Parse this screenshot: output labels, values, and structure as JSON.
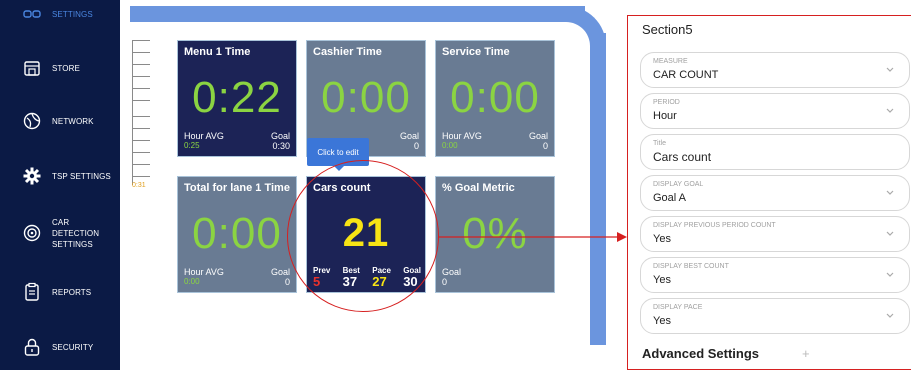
{
  "sidebar": {
    "items": [
      {
        "label": "SETTINGS",
        "icon": "settings-grid-icon",
        "active": true
      },
      {
        "label": "STORE",
        "icon": "store-icon"
      },
      {
        "label": "NETWORK",
        "icon": "network-icon"
      },
      {
        "label": "TSP SETTINGS",
        "icon": "gear-icon"
      },
      {
        "label": "CAR DETECTION SETTINGS",
        "icon": "car-detection-icon"
      },
      {
        "label": "REPORTS",
        "icon": "clipboard-icon"
      },
      {
        "label": "SECURITY",
        "icon": "lock-icon"
      }
    ]
  },
  "timeline": {
    "label": "0:31"
  },
  "tiles": [
    {
      "title": "Menu 1 Time",
      "value": "0:22",
      "foot_left": "Hour AVG",
      "foot_left_sub": "0:25",
      "foot_right": "Goal",
      "foot_right_sub": "0:30"
    },
    {
      "title": "Cashier Time",
      "value": "0:00",
      "foot_right": "Goal",
      "foot_right_sub": "0"
    },
    {
      "title": "Service Time",
      "value": "0:00",
      "foot_left": "Hour AVG",
      "foot_left_sub": "0:00",
      "foot_right": "Goal",
      "foot_right_sub": "0"
    },
    {
      "title": "Total for lane 1 Time",
      "value": "0:00",
      "foot_left": "Hour AVG",
      "foot_left_sub": "0:00",
      "foot_right": "Goal",
      "foot_right_sub": "0"
    },
    {
      "title": "Cars count",
      "value": "21",
      "stats": [
        {
          "label": "Prev",
          "value": "5",
          "color": "#e8322c"
        },
        {
          "label": "Best",
          "value": "37",
          "color": "#ffffff"
        },
        {
          "label": "Pace",
          "value": "27",
          "color": "#f7e414"
        },
        {
          "label": "Goal",
          "value": "30",
          "color": "#ffffff"
        }
      ]
    },
    {
      "title": "% Goal Metric",
      "value": "0%",
      "foot_left": "Goal",
      "foot_left_sub": "0"
    }
  ],
  "tooltip": {
    "text": "Click to edit"
  },
  "panel": {
    "title": "Section5",
    "fields": [
      {
        "label": "MEASURE",
        "value": "CAR COUNT",
        "dropdown": true
      },
      {
        "label": "PERIOD",
        "value": "Hour",
        "dropdown": true
      },
      {
        "label": "Title",
        "value": "Cars count",
        "dropdown": false
      },
      {
        "label": "DISPLAY GOAL",
        "value": "Goal A",
        "dropdown": true
      },
      {
        "label": "DISPLAY PREVIOUS PERIOD COUNT",
        "value": "Yes",
        "dropdown": true
      },
      {
        "label": "DISPLAY BEST COUNT",
        "value": "Yes",
        "dropdown": true
      },
      {
        "label": "DISPLAY PACE",
        "value": "Yes",
        "dropdown": true
      }
    ],
    "advanced_label": "Advanced Settings",
    "advanced_icon": "+"
  },
  "colors": {
    "sidebar_bg": "#0b1a45",
    "tile_dark": "#1c2356",
    "tile_gray": "#697b93",
    "accent_green": "#8bd442",
    "accent_yellow": "#f7e414",
    "highlight_red": "#d62020",
    "track_blue": "#6b95de"
  }
}
